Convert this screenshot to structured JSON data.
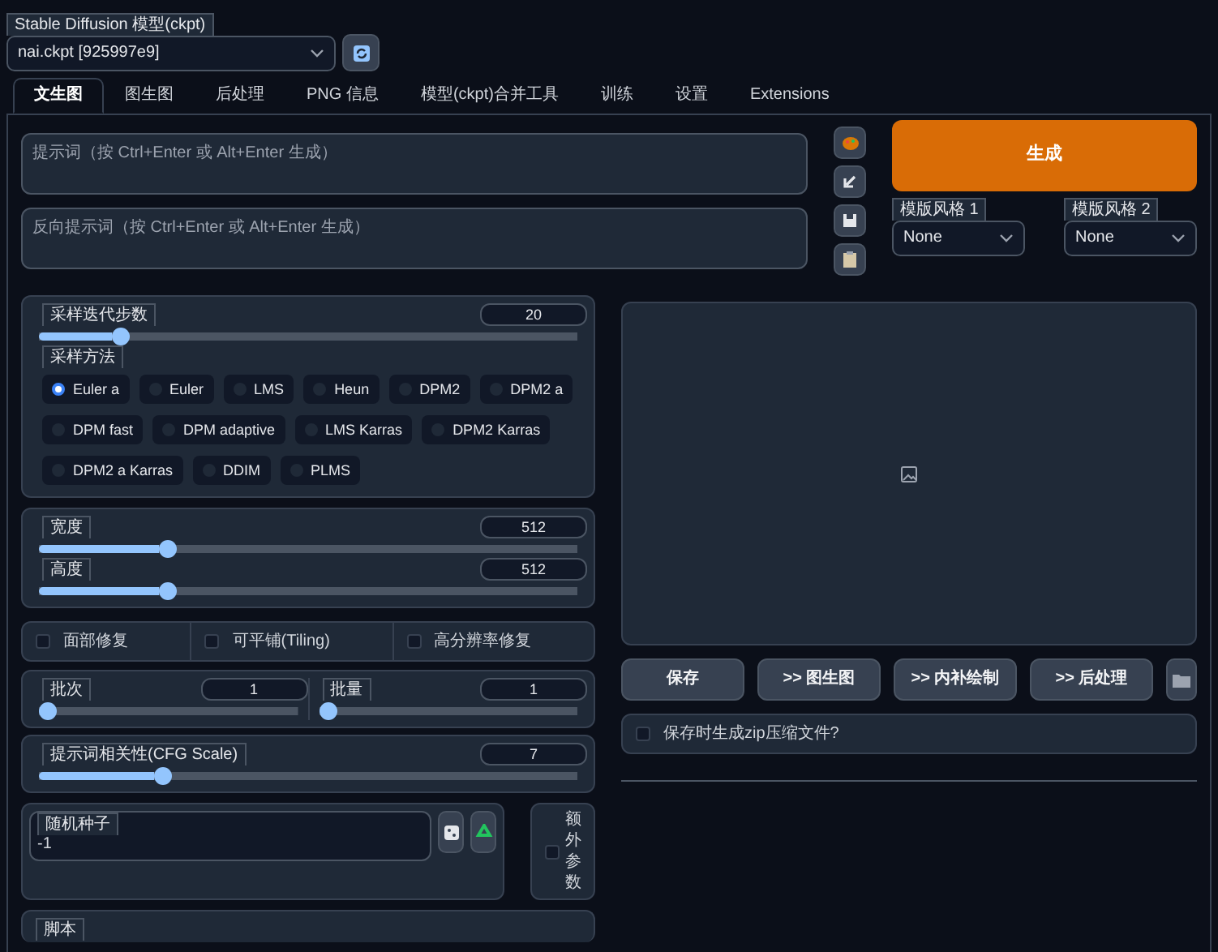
{
  "model": {
    "label": "Stable Diffusion 模型(ckpt)",
    "value": "nai.ckpt [925997e9]"
  },
  "tabs": [
    {
      "label": "文生图",
      "selected": true
    },
    {
      "label": "图生图",
      "selected": false
    },
    {
      "label": "后处理",
      "selected": false
    },
    {
      "label": "PNG 信息",
      "selected": false
    },
    {
      "label": "模型(ckpt)合并工具",
      "selected": false
    },
    {
      "label": "训练",
      "selected": false
    },
    {
      "label": "设置",
      "selected": false
    },
    {
      "label": "Extensions",
      "selected": false
    }
  ],
  "prompt": {
    "placeholder": "提示词（按 Ctrl+Enter 或 Alt+Enter 生成）"
  },
  "negative_prompt": {
    "placeholder": "反向提示词（按 Ctrl+Enter 或 Alt+Enter 生成）"
  },
  "generate_button": "生成",
  "styles": [
    {
      "label": "模版风格 1",
      "value": "None"
    },
    {
      "label": "模版风格 2",
      "value": "None"
    }
  ],
  "steps": {
    "label": "采样迭代步数",
    "value": "20",
    "level": 0.14
  },
  "sampler": {
    "label": "采样方法",
    "options": [
      {
        "label": "Euler a",
        "selected": true
      },
      {
        "label": "Euler",
        "selected": false
      },
      {
        "label": "LMS",
        "selected": false
      },
      {
        "label": "Heun",
        "selected": false
      },
      {
        "label": "DPM2",
        "selected": false
      },
      {
        "label": "DPM2 a",
        "selected": false
      },
      {
        "label": "DPM fast",
        "selected": false
      },
      {
        "label": "DPM adaptive",
        "selected": false
      },
      {
        "label": "LMS Karras",
        "selected": false
      },
      {
        "label": "DPM2 Karras",
        "selected": false
      },
      {
        "label": "DPM2 a Karras",
        "selected": false
      },
      {
        "label": "DDIM",
        "selected": false
      },
      {
        "label": "PLMS",
        "selected": false
      }
    ]
  },
  "width": {
    "label": "宽度",
    "value": "512",
    "level": 0.23
  },
  "height": {
    "label": "高度",
    "value": "512",
    "level": 0.23
  },
  "options": [
    {
      "label": "面部修复",
      "checked": false
    },
    {
      "label": "可平铺(Tiling)",
      "checked": false
    },
    {
      "label": "高分辨率修复",
      "checked": false
    }
  ],
  "batch_count": {
    "label": "批次",
    "value": "1",
    "level": 0
  },
  "batch_size": {
    "label": "批量",
    "value": "1",
    "level": 0
  },
  "cfg_scale": {
    "label": "提示词相关性(CFG Scale)",
    "value": "7",
    "level": 0.22
  },
  "seed": {
    "label": "随机种子",
    "value": "-1"
  },
  "extra": {
    "label": "额外参数",
    "checked": false
  },
  "script": {
    "label": "脚本"
  },
  "output_buttons": [
    "保存",
    ">> 图生图",
    ">> 内补绘制",
    ">> 后处理"
  ],
  "zip": {
    "label": "保存时生成zip压缩文件?",
    "checked": false
  }
}
